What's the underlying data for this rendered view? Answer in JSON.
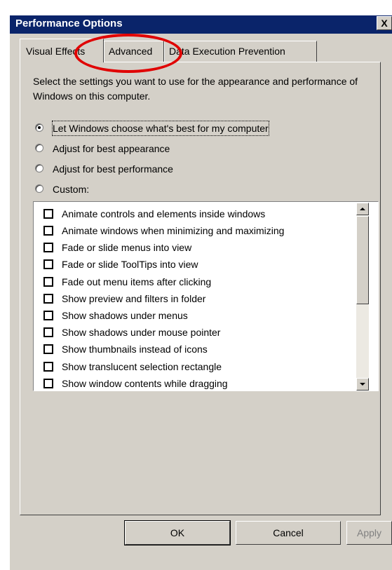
{
  "window": {
    "title": "Performance Options",
    "close_label": "X"
  },
  "tabs": [
    {
      "label": "Visual Effects",
      "selected": true
    },
    {
      "label": "Advanced",
      "selected": false
    },
    {
      "label": "Data Execution Prevention",
      "selected": false
    }
  ],
  "intro_text": "Select the settings you want to use for the appearance and performance of Windows on this computer.",
  "radio_options": [
    {
      "label": "Let Windows choose what's best for my computer",
      "selected": true
    },
    {
      "label": "Adjust for best appearance",
      "selected": false
    },
    {
      "label": "Adjust for best performance",
      "selected": false
    },
    {
      "label": "Custom:",
      "selected": false
    }
  ],
  "effects": [
    {
      "label": "Animate controls and elements inside windows",
      "checked": false
    },
    {
      "label": "Animate windows when minimizing and maximizing",
      "checked": false
    },
    {
      "label": "Fade or slide menus into view",
      "checked": false
    },
    {
      "label": "Fade or slide ToolTips into view",
      "checked": false
    },
    {
      "label": "Fade out menu items after clicking",
      "checked": false
    },
    {
      "label": "Show preview and filters in folder",
      "checked": false
    },
    {
      "label": "Show shadows under menus",
      "checked": false
    },
    {
      "label": "Show shadows under mouse pointer",
      "checked": false
    },
    {
      "label": "Show thumbnails instead of icons",
      "checked": false
    },
    {
      "label": "Show translucent selection rectangle",
      "checked": false
    },
    {
      "label": "Show window contents while dragging",
      "checked": false
    }
  ],
  "buttons": {
    "ok": "OK",
    "cancel": "Cancel",
    "apply": "Apply"
  },
  "colors": {
    "titlebar": "#0a246a",
    "face": "#d4d0c8",
    "annotation": "#e00000"
  }
}
